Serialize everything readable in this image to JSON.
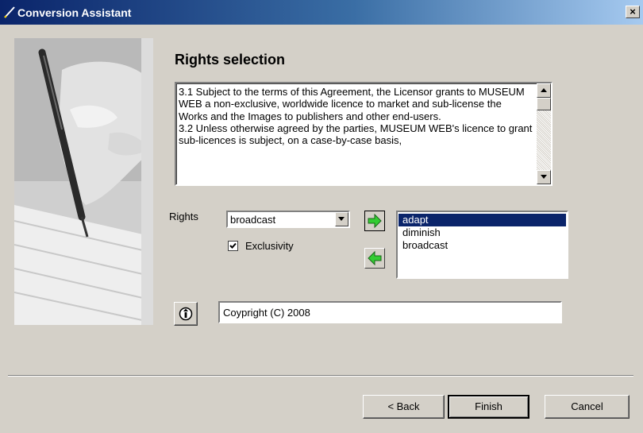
{
  "window": {
    "title": "Conversion Assistant",
    "close_label": "×",
    "title_icon": "pen-icon"
  },
  "page": {
    "heading": "Rights selection"
  },
  "agreement_text": "3.1 Subject to the terms of this Agreement, the Licensor grants to MUSEUM WEB a non-exclusive, worldwide licence to market and sub-license the Works and the Images to publishers and other end-users.\n3.2 Unless otherwise agreed by the parties, MUSEUM WEB's licence to grant sub-licences is subject, on a case-by-case basis,",
  "rights": {
    "label": "Rights",
    "selected": "broadcast",
    "exclusivity_label": "Exclusivity",
    "exclusivity_checked": true,
    "selected_rights": [
      "adapt",
      "diminish",
      "broadcast"
    ],
    "highlighted_index": 0
  },
  "copyright": {
    "value": "Coypright (C) 2008"
  },
  "buttons": {
    "back": "< Back",
    "finish": "Finish",
    "cancel": "Cancel"
  },
  "colors": {
    "selection": "#0a246a",
    "arrow_green": "#33cc33",
    "face": "#d4d0c8"
  }
}
